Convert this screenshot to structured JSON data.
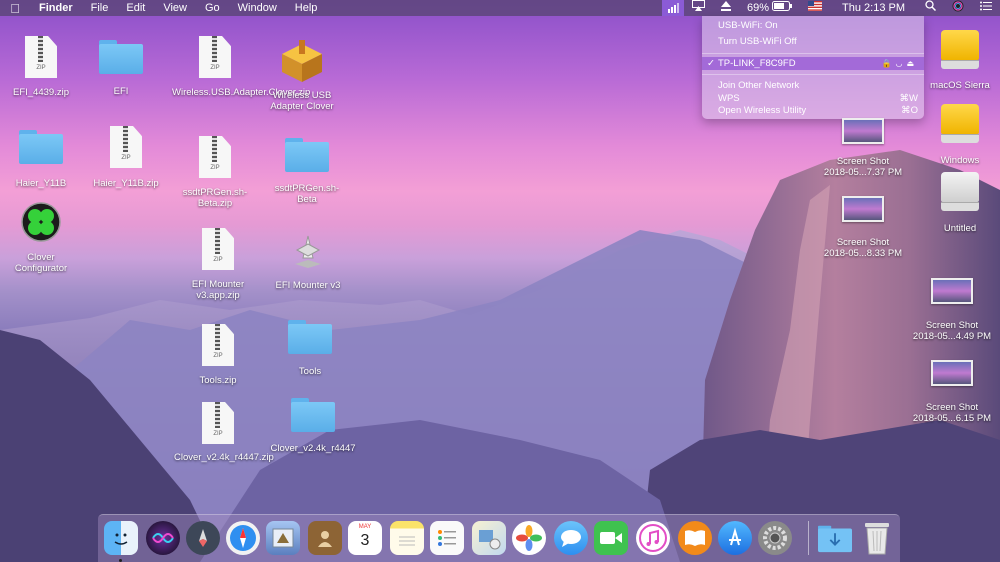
{
  "menubar": {
    "app": "Finder",
    "items": [
      "File",
      "Edit",
      "View",
      "Go",
      "Window",
      "Help"
    ],
    "battery": "69%",
    "clock": "Thu 2:13 PM"
  },
  "wifi_menu": {
    "status": "USB-WiFi: On",
    "toggle": "Turn USB-WiFi Off",
    "network": "TP-LINK_F8C9FD",
    "join_other": "Join Other Network",
    "wps": "WPS",
    "wps_shortcut": "⌘W",
    "open_utility": "Open Wireless Utility",
    "open_utility_shortcut": "⌘O"
  },
  "desktop": {
    "efi_4439_zip": "EFI_4439.zip",
    "efi": "EFI",
    "wireless_adapter_zip": "Wireless.USB.Adapter.Clover.zip",
    "wireless_adapter_clover": "Wireless USB Adapter Clover",
    "haier": "Haier_Y11B",
    "haier_zip": "Haier_Y11B.zip",
    "ssdt_zip": "ssdtPRGen.sh-Beta.zip",
    "ssdt": "ssdtPRGen.sh-Beta",
    "clover_configurator": "Clover Configurator",
    "efi_mounter_zip": "EFI Mounter v3.app.zip",
    "efi_mounter": "EFI Mounter v3",
    "tools_zip": "Tools.zip",
    "tools": "Tools",
    "clover_pkg_zip": "Clover_v2.4k_r4447.zip",
    "clover_pkg": "Clover_v2.4k_r4447",
    "macos_sierra": "macOS Sierra",
    "windows": "Windows",
    "untitled": "Untitled",
    "shot1_a": "Screen Shot",
    "shot1_b": "2018-05...7.37 PM",
    "shot2_a": "Screen Shot",
    "shot2_b": "2018-05...8.33 PM",
    "shot3_a": "Screen Shot",
    "shot3_b": "2018-05...4.49 PM",
    "shot4_a": "Screen Shot",
    "shot4_b": "2018-05...6.15 PM"
  },
  "dock": {
    "calendar_month": "MAY",
    "calendar_day": "3"
  },
  "colors": {
    "accent": "#8b5bd6",
    "menubar": "#5c4678"
  }
}
